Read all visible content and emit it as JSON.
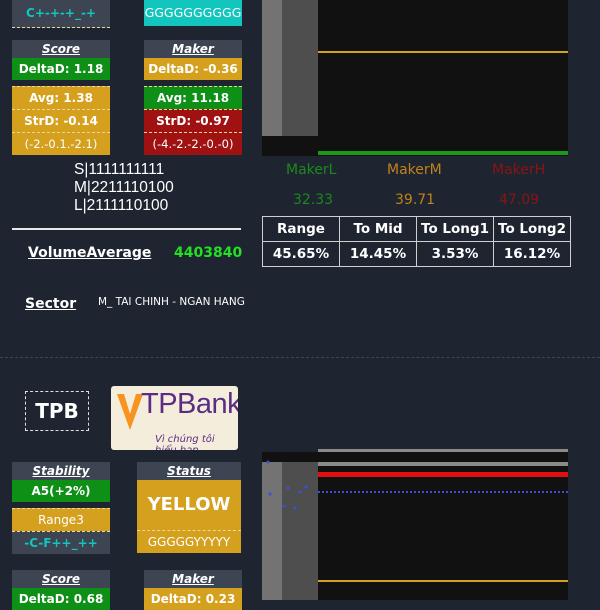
{
  "top": {
    "row0_left": "C+-+-+_-+",
    "row0_right": "GGGGGGGGGG",
    "score_card": {
      "title": "Score",
      "deltad": "DeltaD: 1.18",
      "avg": "Avg: 1.38",
      "strd": "StrD: -0.14",
      "range": "(-2.-0.1.-2.1)"
    },
    "maker_card": {
      "title": "Maker",
      "deltad": "DeltaD: -0.36",
      "avg": "Avg: 11.18",
      "strd": "StrD: -0.97",
      "range": "(-4.-2.-2.-0.-0)"
    },
    "slm_lines": [
      "S|1111111111",
      "M|2211110100",
      "L|2111110100"
    ],
    "volume_label": "VolumeAverage",
    "volume_value": "4403840",
    "sector_label": "Sector",
    "sector_value": "M_ TAI CHINH - NGAN HANG",
    "makers": [
      {
        "name": "MakerL",
        "value": "32.33",
        "color": "#1a8a1a"
      },
      {
        "name": "MakerM",
        "value": "39.71",
        "color": "#c0821a"
      },
      {
        "name": "MakerH",
        "value": "47.09",
        "color": "#8a1414"
      }
    ],
    "stats_headers": [
      "Range",
      "To Mid",
      "To Long1",
      "To Long2"
    ],
    "stats_values": [
      "45.65%",
      "14.45%",
      "3.53%",
      "16.12%"
    ]
  },
  "bottom": {
    "ticker": "TPB",
    "logo_text": "TPBank",
    "logo_tagline": "Vì chúng tôi hiểu bạn",
    "stability_card": {
      "title": "Stability",
      "value1": "A5(+2%)",
      "value2": "Range3",
      "value3": "-C-F++_++"
    },
    "status_card": {
      "title": "Status",
      "value1": "YELLOW",
      "value2": "GGGGGYYYYY"
    },
    "score_card": {
      "title": "Score",
      "deltad": "DeltaD: 0.68"
    },
    "maker_card": {
      "title": "Maker",
      "deltad": "DeltaD: 0.23"
    }
  },
  "colors": {
    "background": "#1e2430",
    "green": "#0e8f16",
    "gold": "#d4a01e",
    "red": "#a01212",
    "teal": "#12c6bd"
  }
}
